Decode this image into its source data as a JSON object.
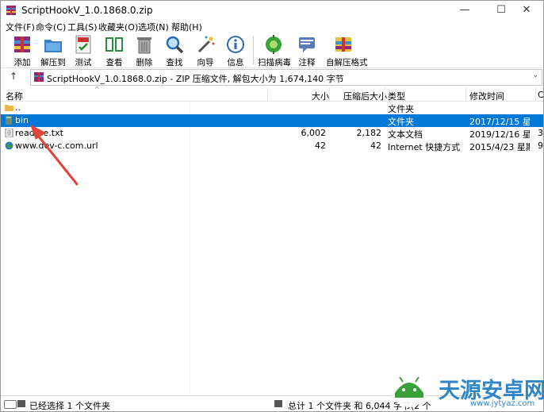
{
  "window": {
    "title": "ScriptHookV_1.0.1868.0.zip",
    "controls": {
      "minimize": "—",
      "maximize": "☐",
      "close": "✕"
    }
  },
  "menu": [
    "文件(F)",
    "命令(C)",
    "工具(S)",
    "收藏夹(O)",
    "选项(N)",
    "帮助(H)"
  ],
  "toolbar": [
    {
      "label": "添加",
      "icon": "add-icon"
    },
    {
      "label": "解压到",
      "icon": "extract-to-icon"
    },
    {
      "label": "测试",
      "icon": "test-icon"
    },
    {
      "label": "查看",
      "icon": "view-icon"
    },
    {
      "label": "删除",
      "icon": "delete-icon"
    },
    {
      "label": "查找",
      "icon": "find-icon"
    },
    {
      "label": "向导",
      "icon": "wizard-icon"
    },
    {
      "label": "信息",
      "icon": "info-icon"
    },
    {
      "label": "扫描病毒",
      "icon": "virus-scan-icon"
    },
    {
      "label": "注释",
      "icon": "comment-icon"
    },
    {
      "label": "自解压格式",
      "icon": "sfx-icon"
    }
  ],
  "address": {
    "up_label": "↑",
    "path": "ScriptHookV_1.0.1868.0.zip - ZIP 压缩文件, 解包大小为 1,674,140 字节",
    "dropdown": "⌄"
  },
  "columns": {
    "name": "名称",
    "size": "大小",
    "packed": "压缩后大小",
    "type": "类型",
    "modified": "修改时间",
    "crc": "CRC"
  },
  "files": [
    {
      "name": "..",
      "size": "",
      "packed": "",
      "type": "文件夹",
      "modified": "",
      "crc": "",
      "icon": "folder-up-icon"
    },
    {
      "name": "bin",
      "size": "",
      "packed": "",
      "type": "文件夹",
      "modified": "2017/12/15 星...",
      "crc": "",
      "icon": "folder-icon",
      "selected": true
    },
    {
      "name": "readme.txt",
      "size": "6,002",
      "packed": "2,182",
      "type": "文本文档",
      "modified": "2019/12/16 星...",
      "crc": "3",
      "icon": "text-file-icon"
    },
    {
      "name": "www.dev-c.com.url",
      "size": "42",
      "packed": "42",
      "type": "Internet 快捷方式",
      "modified": "2015/4/23 星期...",
      "crc": "9",
      "icon": "url-icon"
    }
  ],
  "status": {
    "left": "已经选择 1 个文件夹",
    "right": "总计 1 个文件夹 和 6,044 字节(2 个"
  },
  "watermark": {
    "text": "天源安卓网",
    "url": "www.jytyaz.com"
  },
  "colors": {
    "selection": "#0078d7",
    "arrow": "#e0443a",
    "watermark": "#2e86c8"
  }
}
